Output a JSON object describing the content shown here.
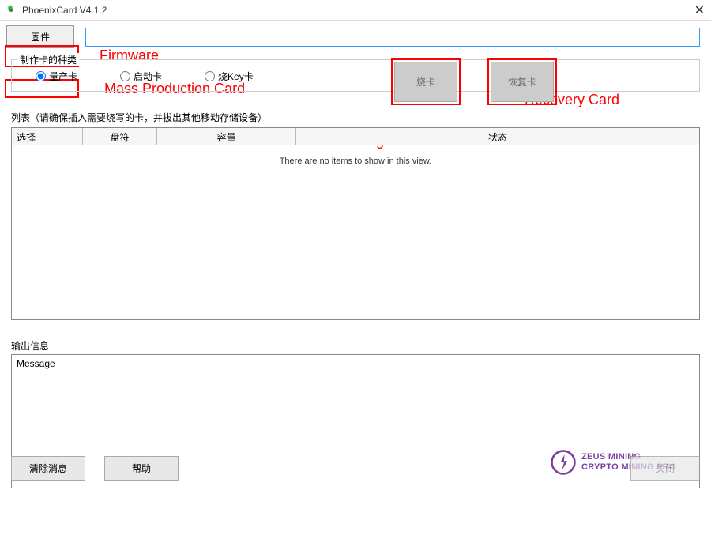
{
  "window": {
    "title": "PhoenixCard V4.1.2"
  },
  "firmware": {
    "button_label": "固件",
    "input_value": ""
  },
  "card_type": {
    "label": "制作卡的种类",
    "options": {
      "mass": "量产卡",
      "startup": "启动卡",
      "key": "烧Key卡"
    },
    "burn_button": "烧卡",
    "recover_button": "恢复卡"
  },
  "annotations": {
    "firmware": "Firmware",
    "mass_production": "Mass Production Card",
    "burning": "Burning card",
    "recovery": "Recovery Card"
  },
  "list": {
    "label": "列表（请确保插入需要烧写的卡，并拔出其他移动存储设备）",
    "headers": {
      "select": "选择",
      "drive": "盘符",
      "capacity": "容量",
      "status": "状态"
    },
    "empty_text": "There are no items to show in this view."
  },
  "output": {
    "label": "输出信息",
    "message": "Message"
  },
  "bottom": {
    "clear": "清除消息",
    "help": "帮助",
    "restore_close": "关闭"
  },
  "logo": {
    "line1": "ZEUS MINING",
    "line2": "CRYPTO MINING PRO"
  }
}
